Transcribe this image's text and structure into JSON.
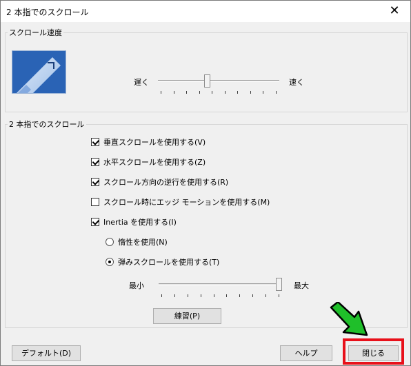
{
  "window": {
    "title": "2 本指でのスクロール",
    "close_glyph": "✕"
  },
  "speed_group": {
    "legend": "スクロール速度",
    "slow_label": "遅く",
    "fast_label": "速く",
    "slider_value_fraction": 0.4
  },
  "scroll_group": {
    "legend": "2 本指でのスクロール",
    "checkboxes": [
      {
        "label": "垂直スクロールを使用する(V)",
        "checked": true
      },
      {
        "label": "水平スクロールを使用する(Z)",
        "checked": true
      },
      {
        "label": "スクロール方向の逆行を使用する(R)",
        "checked": true
      },
      {
        "label": "スクロール時にエッジ モーションを使用する(M)",
        "checked": false
      },
      {
        "label": "Inertia  を使用する(I)",
        "checked": true
      }
    ],
    "radios": [
      {
        "label": "惰性を使用(N)",
        "checked": false
      },
      {
        "label": "弾みスクロールを使用する(T)",
        "checked": true
      }
    ],
    "min_label": "最小",
    "max_label": "最大",
    "inertia_slider_value_fraction": 1.0,
    "practice_button": "練習(P)"
  },
  "footer": {
    "default_button": "デフォルト(D)",
    "help_button": "ヘルプ",
    "close_button": "閉じる"
  },
  "annotation": {
    "highlight_color": "#e8101a",
    "arrow_color": "#1fbf2a"
  }
}
